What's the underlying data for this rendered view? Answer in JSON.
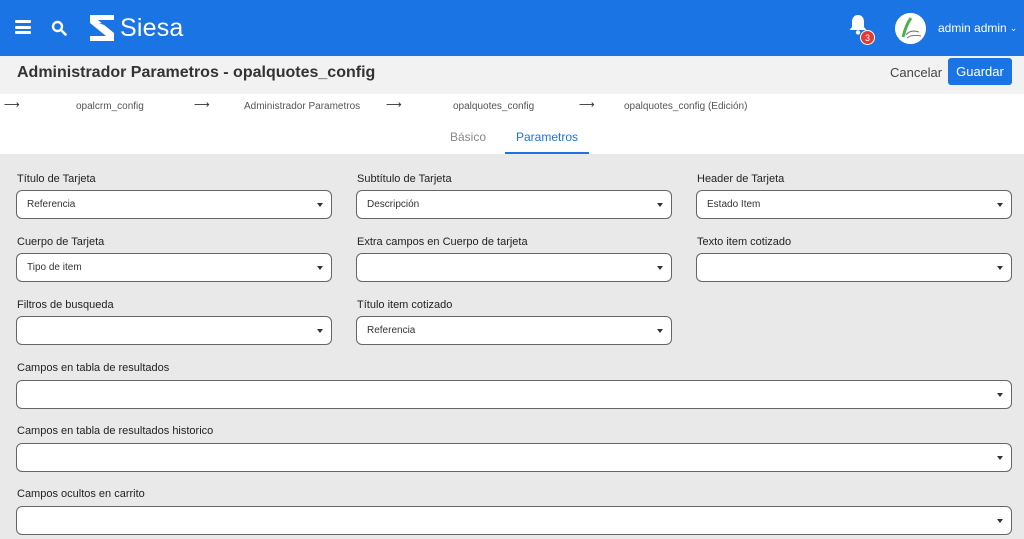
{
  "header": {
    "logo_text": "Siesa",
    "notifications_count": "3",
    "user_name": "admin admin",
    "accent": "#1b74e4"
  },
  "titlebar": {
    "title": "Administrador Parametros - opalquotes_config",
    "cancel_label": "Cancelar",
    "save_label": "Guardar"
  },
  "breadcrumb": [
    "opalcrm_config",
    "Administrador Parametros",
    "opalquotes_config",
    "opalquotes_config (Edición)"
  ],
  "tabs": [
    {
      "label": "Básico",
      "active": false
    },
    {
      "label": "Parametros",
      "active": true
    }
  ],
  "form": {
    "titulo_tarjeta": {
      "label": "Título de Tarjeta",
      "value": "Referencia"
    },
    "subtitulo_tarjeta": {
      "label": "Subtítulo de Tarjeta",
      "value": "Descripción"
    },
    "header_tarjeta": {
      "label": "Header de Tarjeta",
      "value": "Estado Item"
    },
    "cuerpo_tarjeta": {
      "label": "Cuerpo de Tarjeta",
      "value": "Tipo de item"
    },
    "extra_campos": {
      "label": "Extra campos en Cuerpo de tarjeta",
      "value": ""
    },
    "texto_item_cotizado": {
      "label": "Texto item cotizado",
      "value": ""
    },
    "filtros_busqueda": {
      "label": "Filtros de busqueda",
      "value": ""
    },
    "titulo_item_cotizado": {
      "label": "Título item cotizado",
      "value": "Referencia"
    },
    "campos_tabla_resultados": {
      "label": "Campos en tabla de resultados",
      "value": ""
    },
    "campos_tabla_historico": {
      "label": "Campos en tabla de resultados historico",
      "value": ""
    },
    "campos_ocultos_carrito": {
      "label": "Campos ocultos en carrito",
      "value": ""
    }
  }
}
